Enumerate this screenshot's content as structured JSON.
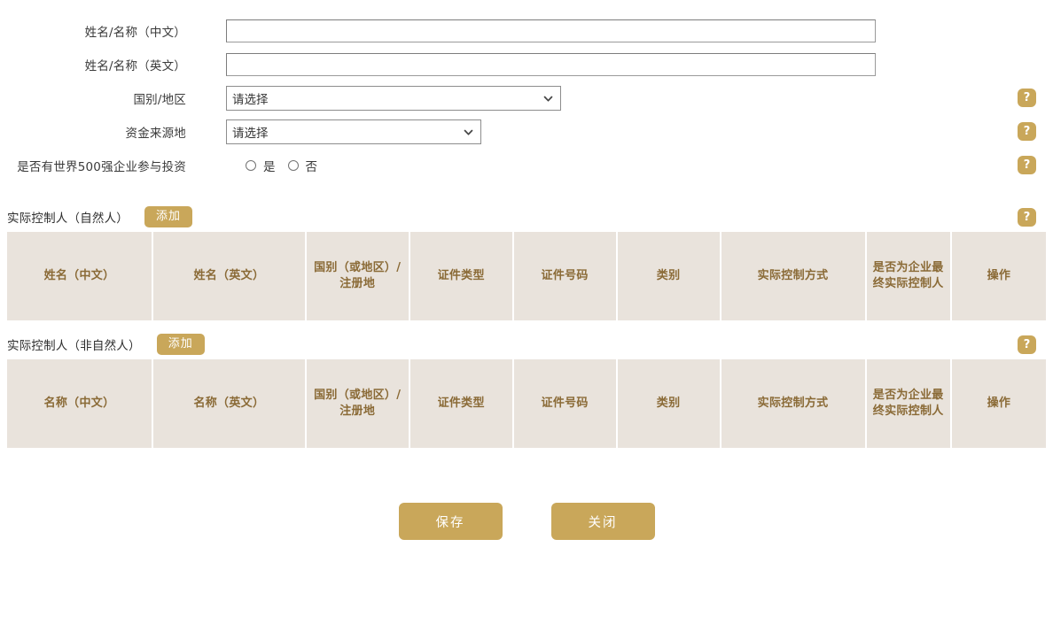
{
  "form": {
    "fields": [
      {
        "label": "姓名/名称（中文）",
        "type": "text",
        "value": "",
        "placeholder": "",
        "has_help": false
      },
      {
        "label": "姓名/名称（英文）",
        "type": "text",
        "value": "",
        "placeholder": "",
        "has_help": false
      },
      {
        "label": "国别/地区",
        "type": "select",
        "value": "请选择",
        "has_help": true
      },
      {
        "label": "资金来源地",
        "type": "select",
        "value": "请选择",
        "has_help": true
      },
      {
        "label": "是否有世界500强企业参与投资",
        "type": "radio",
        "has_help": true
      }
    ],
    "radio_options": [
      {
        "label": "是",
        "selected": false
      },
      {
        "label": "否",
        "selected": false
      }
    ]
  },
  "sections": [
    {
      "title": "实际控制人（自然人）",
      "add_label": "添加",
      "has_help": true,
      "columns": [
        "姓名（中文）",
        "姓名（英文）",
        "国别（或地区）/注册地",
        "证件类型",
        "证件号码",
        "类别",
        "实际控制方式",
        "是否为企业最终实际控制人",
        "操作"
      ]
    },
    {
      "title": "实际控制人（非自然人）",
      "add_label": "添加",
      "has_help": true,
      "columns": [
        "名称（中文）",
        "名称（英文）",
        "国别（或地区）/注册地",
        "证件类型",
        "证件号码",
        "类别",
        "实际控制方式",
        "是否为企业最终实际控制人",
        "操作"
      ]
    }
  ],
  "footer": {
    "save_label": "保存",
    "close_label": "关闭"
  },
  "icons": {
    "help": "?"
  },
  "colors": {
    "accent_gold": "#c9a75a",
    "table_header_bg": "#e9e3dc",
    "table_header_text": "#8a6a36",
    "page_bg": "#ffffff"
  }
}
